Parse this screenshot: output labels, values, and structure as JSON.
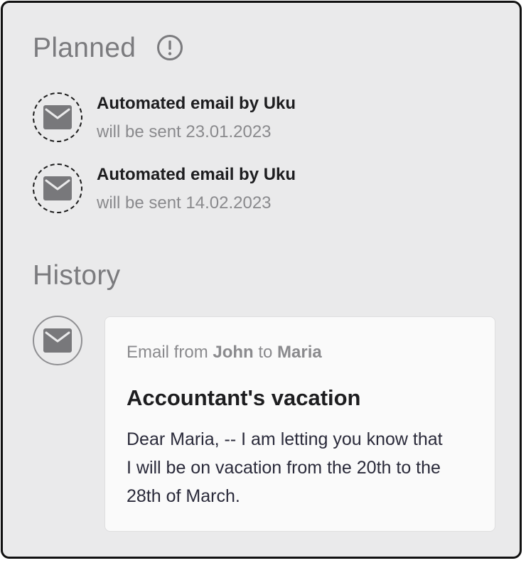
{
  "planned": {
    "title": "Planned",
    "info_icon": "exclamation-circle-icon",
    "items": [
      {
        "title": "Automated email by Uku",
        "subtitle": "will be sent 23.01.2023",
        "icon": "envelope-icon"
      },
      {
        "title": "Automated email by Uku",
        "subtitle": "will be sent 14.02.2023",
        "icon": "envelope-icon"
      }
    ]
  },
  "history": {
    "title": "History",
    "items": [
      {
        "icon": "envelope-icon",
        "meta_prefix": "Email from",
        "sender": "John",
        "meta_middle": "to",
        "recipient": "Maria",
        "subject": "Accountant's vacation",
        "body": "Dear Maria, -- I am letting you know that I will be on vacation from the 20th to the 28th of March."
      }
    ]
  },
  "colors": {
    "panel_bg": "#eaeaeb",
    "panel_border": "#111111",
    "muted_text": "#8a8a8d",
    "heading_text": "#7b7b7e",
    "icon_gray": "#78787b",
    "card_bg": "#fafafa"
  }
}
